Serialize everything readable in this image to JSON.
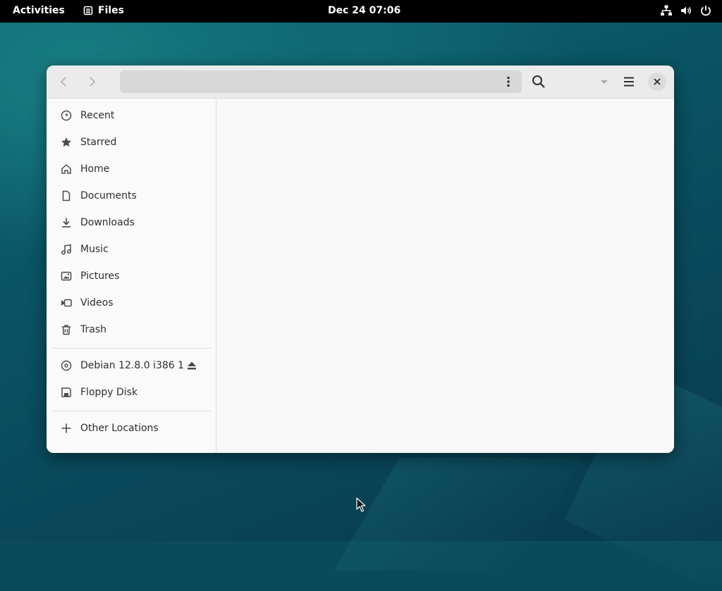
{
  "topbar": {
    "activities": "Activities",
    "app_name": "Files",
    "clock": "Dec 24  07:06",
    "tray_icons": [
      "network-icon",
      "volume-icon",
      "power-icon"
    ]
  },
  "window": {
    "pathbar_text": "",
    "sidebar": {
      "places": [
        {
          "label": "Recent",
          "icon": "clock-icon"
        },
        {
          "label": "Starred",
          "icon": "star-icon"
        },
        {
          "label": "Home",
          "icon": "home-icon"
        },
        {
          "label": "Documents",
          "icon": "document-icon"
        },
        {
          "label": "Downloads",
          "icon": "download-icon"
        },
        {
          "label": "Music",
          "icon": "music-icon"
        },
        {
          "label": "Pictures",
          "icon": "picture-icon"
        },
        {
          "label": "Videos",
          "icon": "video-icon"
        },
        {
          "label": "Trash",
          "icon": "trash-icon"
        }
      ],
      "devices": [
        {
          "label": "Debian 12.8.0 i386 1",
          "icon": "disc-icon",
          "eject": true
        },
        {
          "label": "Floppy Disk",
          "icon": "floppy-icon"
        }
      ],
      "other": {
        "label": "Other Locations",
        "icon": "plus-icon"
      }
    }
  },
  "colors": {
    "topbar_bg": "#000000",
    "window_bg": "#fafafa",
    "headerbar_bg": "#ebebeb",
    "desktop_accent": "#0a5564"
  }
}
